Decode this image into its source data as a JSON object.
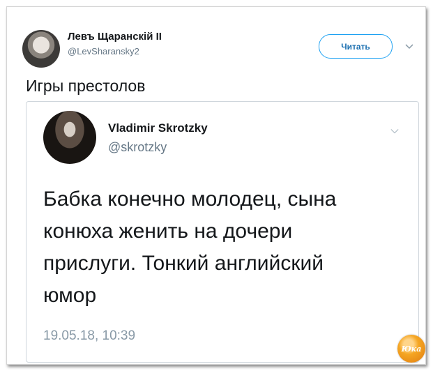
{
  "tweet": {
    "author_name": "Левъ Щаранскій II",
    "author_handle": "@LevSharansky2",
    "follow_label": "Читать",
    "text": "Игры престолов"
  },
  "quoted_tweet": {
    "author_name": "Vladimir Skrotzky",
    "author_handle": "@skrotzky",
    "text": "Бабка конечно молодец, сына конюха женить на дочери прислуги. Тонкий английский юмор",
    "timestamp": "19.05.18, 10:39"
  },
  "watermark": {
    "text": "Юка"
  },
  "colors": {
    "accent": "#1da1f2",
    "text_primary": "#14171a",
    "text_secondary": "#657786",
    "timestamp": "#8899a6",
    "watermark": "#f5a623"
  },
  "icons": {
    "menu_caret": "chevron-down-icon"
  }
}
